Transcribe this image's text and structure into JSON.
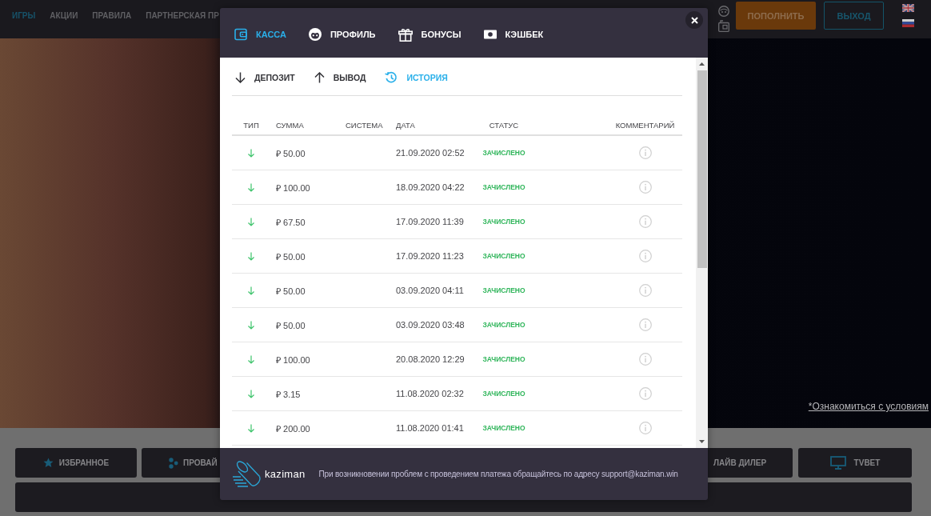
{
  "top_nav": {
    "items": [
      {
        "label": "ИГРЫ",
        "selected": true
      },
      {
        "label": "АКЦИИ",
        "selected": false
      },
      {
        "label": "ПРАВИЛА",
        "selected": false
      },
      {
        "label": "ПАРТНЕРСКАЯ ПР",
        "selected": false
      }
    ],
    "deposit_button": "ПОПОЛНИТЬ",
    "logout_button": "ВЫХОД",
    "languages": [
      {
        "kind": "uk"
      },
      {
        "kind": "ru"
      }
    ]
  },
  "banner": {
    "terms_link": "*Ознакомиться с условиям"
  },
  "categories": [
    {
      "label": "ИЗБРАННОЕ",
      "kind": "star"
    },
    {
      "label": "ПРОВАЙ",
      "kind": "providers"
    },
    {
      "label": "ЛАЙВ ДИЛЕР"
    },
    {
      "label": "TVBET",
      "kind": "monitor"
    }
  ],
  "modal": {
    "tabs": [
      {
        "label": "КАССА",
        "kind": "wallet",
        "selected": true
      },
      {
        "label": "ПРОФИЛЬ",
        "kind": "face",
        "selected": false
      },
      {
        "label": "БОНУСЫ",
        "kind": "gift",
        "selected": false
      },
      {
        "label": "КЭШБЕК",
        "kind": "banknote",
        "selected": false
      }
    ],
    "sub_tabs": [
      {
        "label": "ДЕПОЗИТ",
        "kind": "down",
        "selected": false
      },
      {
        "label": "ВЫВОД",
        "kind": "up",
        "selected": false
      },
      {
        "label": "ИСТОРИЯ",
        "kind": "history",
        "selected": true
      }
    ],
    "table": {
      "columns": [
        "ТИП",
        "СУММА",
        "СИСТЕМА",
        "ДАТА",
        "СТАТУС",
        "КОММЕНТАРИЙ"
      ],
      "rows": [
        {
          "kind": "deposit",
          "amount": "₽ 50.00",
          "date": "21.09.2020 02:52",
          "status": "ЗАЧИСЛЕНО"
        },
        {
          "kind": "deposit",
          "amount": "₽ 100.00",
          "date": "18.09.2020 04:22",
          "status": "ЗАЧИСЛЕНО"
        },
        {
          "kind": "deposit",
          "amount": "₽ 67.50",
          "date": "17.09.2020 11:39",
          "status": "ЗАЧИСЛЕНО"
        },
        {
          "kind": "deposit",
          "amount": "₽ 50.00",
          "date": "17.09.2020 11:23",
          "status": "ЗАЧИСЛЕНО"
        },
        {
          "kind": "deposit",
          "amount": "₽ 50.00",
          "date": "03.09.2020 04:11",
          "status": "ЗАЧИСЛЕНО"
        },
        {
          "kind": "deposit",
          "amount": "₽ 50.00",
          "date": "03.09.2020 03:48",
          "status": "ЗАЧИСЛЕНО"
        },
        {
          "kind": "deposit",
          "amount": "₽ 100.00",
          "date": "20.08.2020 12:29",
          "status": "ЗАЧИСЛЕНО"
        },
        {
          "kind": "deposit",
          "amount": "₽ 3.15",
          "date": "11.08.2020 02:32",
          "status": "ЗАЧИСЛЕНО"
        },
        {
          "kind": "deposit",
          "amount": "₽ 200.00",
          "date": "11.08.2020 01:41",
          "status": "ЗАЧИСЛЕНО"
        }
      ]
    },
    "footer": {
      "logo": "kaziman",
      "notice": "При возникновении проблем с проведением платежа обращайтесь по адресу support@kaziman.win"
    }
  }
}
